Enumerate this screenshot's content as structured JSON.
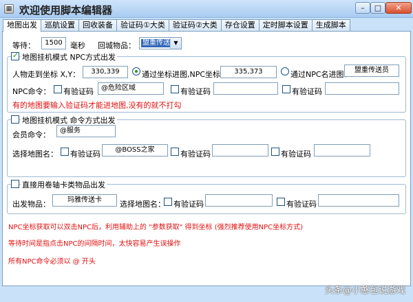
{
  "window": {
    "title": "欢迎使用脚本编辑器",
    "minimize": "–",
    "maximize": "□",
    "close": "✕"
  },
  "tabs": [
    "地图出发",
    "巡航设置",
    "回收装备",
    "验证码①大类",
    "验证码②大类",
    "存仓设置",
    "定时脚本设置",
    "生成脚本"
  ],
  "top": {
    "wait_label": "等待：",
    "wait_value": "1500",
    "wait_unit": "毫秒",
    "return_item_label": "回城物品：",
    "return_item_value": "盟重传送石"
  },
  "group1": {
    "title": "地图挂机模式   NPC方式出发",
    "coord_label": "人物走到坐标 X,Y：",
    "coord_value": "330,339",
    "via_coord_label": "通过坐标进图,NPC坐标：",
    "npc_coord_value": "335,373",
    "via_name_label": "通过NPC名进图：",
    "npc_name_value": "盟重传送员",
    "npc_cmd_label": "NPC命令：",
    "captcha_label": "有验证码",
    "cmd1_value": "@危险区域",
    "warning": "有的地图要输入验证码才能进地图,没有的就不打勾"
  },
  "group2": {
    "title": "地图挂机模式   命令方式出发",
    "member_cmd_label": "会员命令：",
    "member_cmd_value": "@服务",
    "map_name_label": "选择地图名：",
    "captcha_label": "有验证码",
    "map1_value": "@BOSS之家"
  },
  "group3": {
    "title": "直接用卷轴卡类物品出发",
    "depart_item_label": "出发物品：",
    "depart_item_value": "玛雅传送卡",
    "map_name_label": "选择地图名：",
    "captcha_label": "有验证码"
  },
  "notes": [
    "NPC坐标获取可以双击NPC后，利用辅助上的 \"参数获取\" 得到坐标  (强烈推荐使用NPC坐标方式)",
    "等待时间是指点击NPC的间隔时间，太快容易产生误操作",
    "所有NPC命令必须以 @ 开头"
  ],
  "watermark": "头条@小憨包说游戏"
}
